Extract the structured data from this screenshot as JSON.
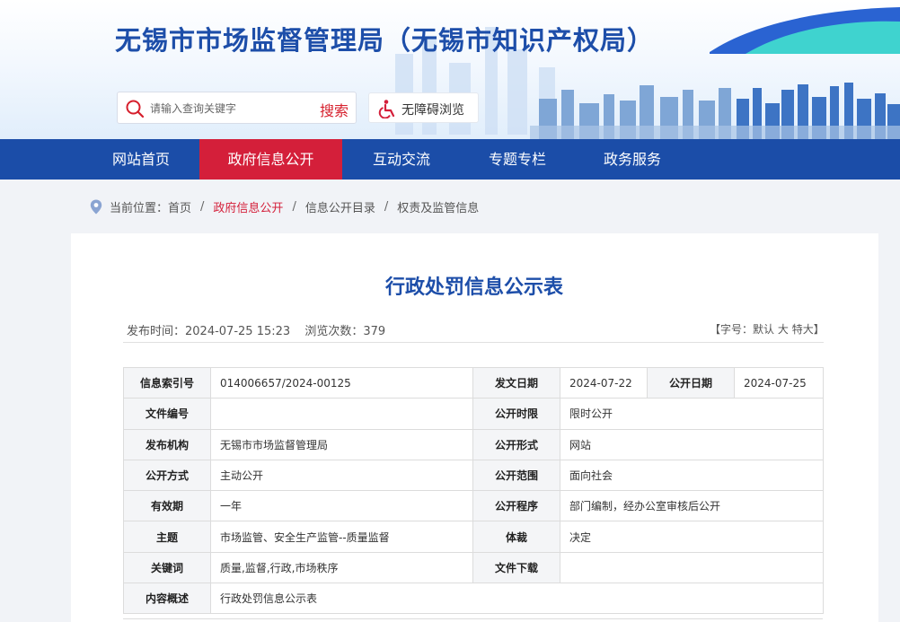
{
  "header": {
    "site_title": "无锡市市场监督管理局（无锡市知识产权局）",
    "search": {
      "placeholder": "请输入查询关键字",
      "button_label": "搜索"
    },
    "accessibility_label": "无障碍浏览"
  },
  "nav": {
    "items": [
      {
        "label": "网站首页"
      },
      {
        "label": "政府信息公开"
      },
      {
        "label": "互动交流"
      },
      {
        "label": "专题专栏"
      },
      {
        "label": "政务服务"
      }
    ],
    "active_index": 1
  },
  "breadcrumb": {
    "prefix": "当前位置：",
    "items": [
      "首页",
      "政府信息公开",
      "信息公开目录",
      "权责及监管信息"
    ],
    "separator": "/"
  },
  "article": {
    "title": "行政处罚信息公示表",
    "publish_label": "发布时间：",
    "publish_time": "2024-07-25 15:23",
    "views_label": "浏览次数：",
    "views": "379",
    "font_size": {
      "open": "【字号：",
      "default": "默认",
      "large": "大",
      "xlarge": "特大",
      "close": "】"
    }
  },
  "info_table": {
    "index_no": {
      "label": "信息索引号",
      "value": "014006657/2024-00125"
    },
    "doc_date": {
      "label": "发文日期",
      "value": "2024-07-22"
    },
    "open_date": {
      "label": "公开日期",
      "value": "2024-07-25"
    },
    "doc_no": {
      "label": "文件编号",
      "value": ""
    },
    "open_limit": {
      "label": "公开时限",
      "value": "限时公开"
    },
    "publisher": {
      "label": "发布机构",
      "value": "无锡市市场监督管理局"
    },
    "open_form": {
      "label": "公开形式",
      "value": "网站"
    },
    "open_method": {
      "label": "公开方式",
      "value": "主动公开"
    },
    "open_scope": {
      "label": "公开范围",
      "value": "面向社会"
    },
    "validity": {
      "label": "有效期",
      "value": "一年"
    },
    "open_procedure": {
      "label": "公开程序",
      "value": "部门编制，经办公室审核后公开"
    },
    "subject": {
      "label": "主题",
      "value": "市场监管、安全生产监管--质量监督"
    },
    "genre": {
      "label": "体裁",
      "value": "决定"
    },
    "keywords": {
      "label": "关键词",
      "value": "质量,监督,行政,市场秩序"
    },
    "download": {
      "label": "文件下载",
      "value": ""
    },
    "summary": {
      "label": "内容概述",
      "value": "行政处罚信息公示表"
    }
  },
  "colors": {
    "brand_blue": "#1b4da8",
    "active_red": "#d41f3a",
    "title_blue": "#1d4ea9"
  }
}
